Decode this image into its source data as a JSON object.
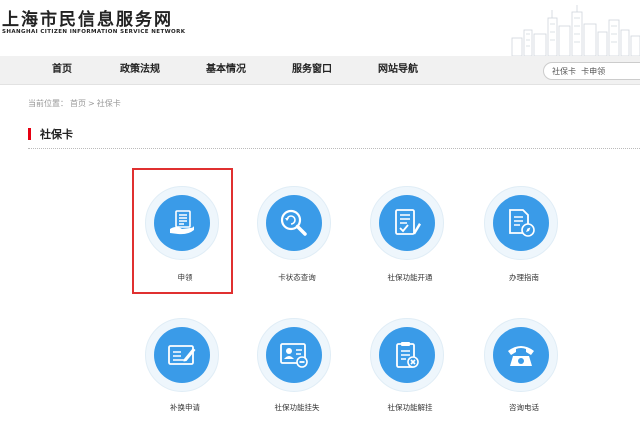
{
  "site": {
    "title": "上海市民信息服务网",
    "subtitle": "SHANGHAI CITIZEN INFORMATION SERVICE NETWORK"
  },
  "nav": {
    "items": [
      "首页",
      "政策法规",
      "基本情况",
      "服务窗口",
      "网站导航"
    ]
  },
  "search": {
    "value": "社保卡  卡申领"
  },
  "breadcrumb": {
    "prefix": "当前位置：",
    "home": "首页",
    "separator": ">",
    "current": "社保卡"
  },
  "section": {
    "title": "社保卡"
  },
  "services": [
    {
      "label": "申领",
      "icon": "hand-document-icon"
    },
    {
      "label": "卡状态查询",
      "icon": "search-refresh-icon"
    },
    {
      "label": "社保功能开通",
      "icon": "checklist-pen-icon"
    },
    {
      "label": "办理指南",
      "icon": "document-compass-icon"
    },
    {
      "label": "补换申请",
      "icon": "card-pen-icon"
    },
    {
      "label": "社保功能挂失",
      "icon": "id-card-minus-icon"
    },
    {
      "label": "社保功能解挂",
      "icon": "clipboard-cancel-icon"
    },
    {
      "label": "咨询电话",
      "icon": "telephone-icon"
    }
  ],
  "colors": {
    "accent": "#3a9be8",
    "highlight": "#e03030",
    "section_marker": "#e60012"
  }
}
